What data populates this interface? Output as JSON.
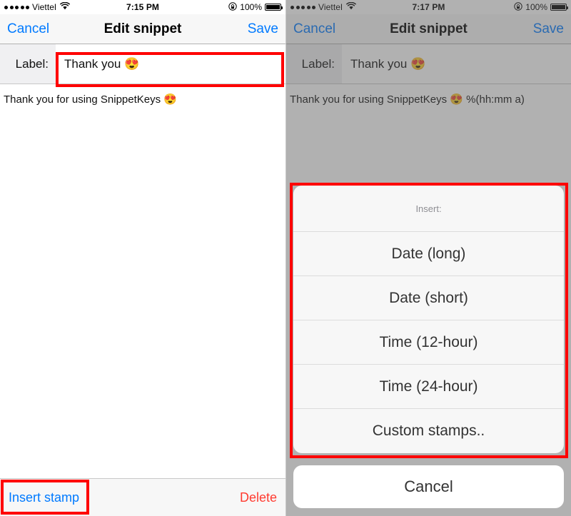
{
  "left": {
    "status_bar": {
      "signal_dots": 5,
      "carrier": "Viettel",
      "wifi_icon": "wifi-icon",
      "time": "7:15 PM",
      "rotation_lock_icon": "rotation-lock-icon",
      "battery_percent": "100%",
      "battery_icon": "battery-full-icon"
    },
    "nav": {
      "cancel_label": "Cancel",
      "title": "Edit snippet",
      "save_label": "Save"
    },
    "form": {
      "label_caption": "Label:",
      "label_value": "Thank you 😍"
    },
    "body_text": "Thank you for using SnippetKeys 😍",
    "toolbar": {
      "insert_stamp_label": "Insert stamp",
      "delete_label": "Delete"
    }
  },
  "right": {
    "status_bar": {
      "signal_dots": 5,
      "carrier": "Viettel",
      "wifi_icon": "wifi-icon",
      "time": "7:17 PM",
      "rotation_lock_icon": "rotation-lock-icon",
      "battery_percent": "100%",
      "battery_icon": "battery-full-icon"
    },
    "nav": {
      "cancel_label": "Cancel",
      "title": "Edit snippet",
      "save_label": "Save"
    },
    "form": {
      "label_caption": "Label:",
      "label_value": "Thank you 😍"
    },
    "body_text": "Thank you for using SnippetKeys 😍 %(hh:mm a)",
    "action_sheet": {
      "header": "Insert:",
      "items": [
        {
          "label": "Date (long)"
        },
        {
          "label": "Date (short)"
        },
        {
          "label": "Time (12-hour)"
        },
        {
          "label": "Time (24-hour)"
        },
        {
          "label": "Custom stamps.."
        }
      ],
      "cancel_label": "Cancel"
    }
  },
  "colors": {
    "accent_blue": "#007aff",
    "destructive_red": "#ff3b30",
    "annotation_red": "#ff0000",
    "nav_bar_bg": "#f7f7f7",
    "sheet_bg": "#f7f7f7"
  }
}
